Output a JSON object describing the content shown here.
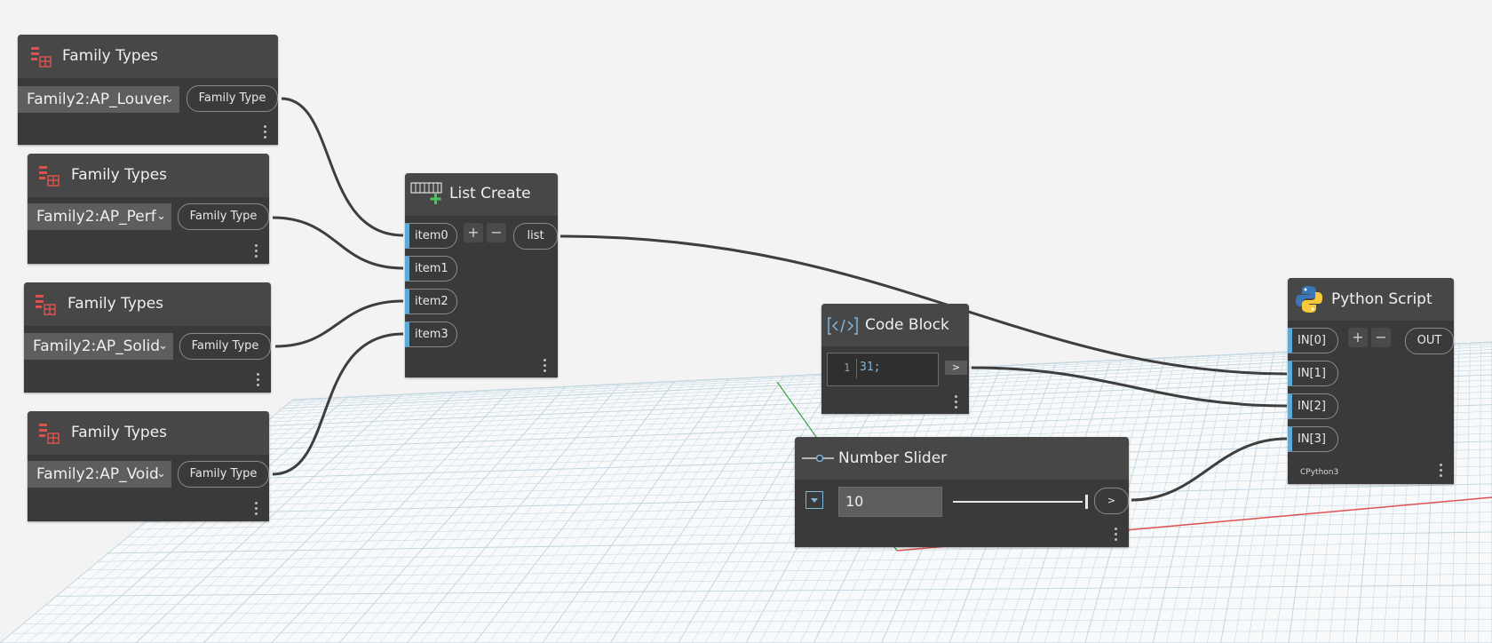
{
  "colors": {
    "canvas_bg": "#f3f3f3",
    "node_body": "#3a3a3a",
    "node_header": "#474747",
    "input_port_accent": "#5fa9d6",
    "wire": "#3e3e3e",
    "grid_line": "#bfd3dd",
    "axis_x": "#e05050",
    "axis_y": "#3aa040"
  },
  "family_types_nodes": [
    {
      "title": "Family Types",
      "selected_value": "Family2:AP_Louver",
      "output_label": "Family Type",
      "icon": "family-types-icon"
    },
    {
      "title": "Family Types",
      "selected_value": "Family2:AP_Perf",
      "output_label": "Family Type",
      "icon": "family-types-icon"
    },
    {
      "title": "Family Types",
      "selected_value": "Family2:AP_Solid",
      "output_label": "Family Type",
      "icon": "family-types-icon"
    },
    {
      "title": "Family Types",
      "selected_value": "Family2:AP_Void",
      "output_label": "Family Type",
      "icon": "family-types-icon"
    }
  ],
  "list_create": {
    "title": "List Create",
    "icon": "list-create-icon",
    "inputs": [
      "item0",
      "item1",
      "item2",
      "item3"
    ],
    "output_label": "list",
    "add_label": "+",
    "remove_label": "−"
  },
  "code_block": {
    "title": "Code Block",
    "icon": "code-block-icon",
    "line_number": "1",
    "code": "31;",
    "output_label": ">"
  },
  "number_slider": {
    "title": "Number Slider",
    "icon": "slider-icon",
    "value": "10",
    "output_label": ">",
    "expand_icon": "chevron-down-icon"
  },
  "python_script": {
    "title": "Python Script",
    "icon": "python-icon",
    "inputs": [
      "IN[0]",
      "IN[1]",
      "IN[2]",
      "IN[3]"
    ],
    "output_label": "OUT",
    "engine": "CPython3",
    "add_label": "+",
    "remove_label": "−"
  }
}
